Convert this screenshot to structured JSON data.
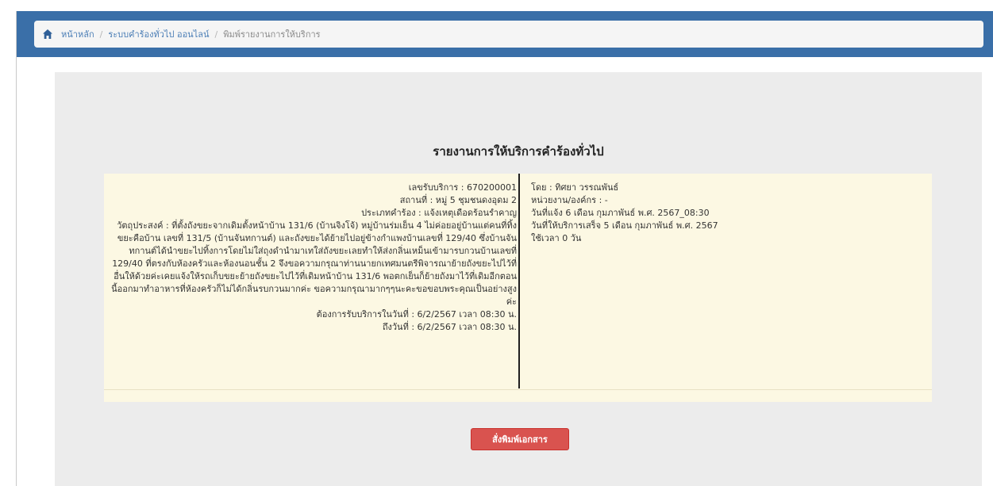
{
  "breadcrumb": {
    "items": [
      {
        "label": "หน้าหลัก"
      },
      {
        "label": "ระบบคำร้องทั่วไป ออนไลน์"
      },
      {
        "label": "พิมพ์รายงานการให้บริการ"
      }
    ],
    "separator": "/"
  },
  "report": {
    "title": "รายงานการให้บริการคำร้องทั่วไป",
    "left": {
      "service_no": "เลขรับบริการ : 670200001",
      "location": "สถานที่ : หมู่ 5 ชุมชนดงอุดม 2",
      "request_type": "ประเภทคำร้อง : แจ้งเหตุเดือดร้อนรำคาญ",
      "purpose": "วัตถุประสงค์ : ที่ตั้งถังขยะจากเดิมตั้งหน้าบ้าน 131/6 (บ้านจิงโจ้) หมู่บ้านร่มเย็น 4 ไม่ค่อยอยู่บ้านแต่คนที่ทิ้งขยะคือบ้าน เลขที่ 131/5 (บ้านจันทกานต์) และถังขยะได้ย้ายไปอยู่ข้างกำแพงบ้านเลขที่ 129/40 ซึ่งบ้านจันทกานต์ได้นำขยะไปทิ้งการโดยไม่ใส่ถุงดำนำมาเทใส่ถังขยะเลยทำให้ส่งกลิ่นเหม็นเข้ามารบกวนบ้านเลขที่ 129/40 ที่ตรงกับห้องครัวและห้องนอนชั้น 2 จึงขอความกรุณาท่านนายกเทศมนตรีพิจารณาย้ายถังขยะไปไว้ที่อื่นให้ด้วยค่ะเคยแจ้งให้รถเก็บขยะย้ายถังขยะไปไว้ที่เดิมหน้าบ้าน 131/6 พอตกเย็นก็ย้ายถังมาไว้ที่เดิมอีกตอนนี้ออกมาทำอาหารที่ห้องครัวก็ไม่ได้กลิ่นรบกวนมากค่ะ ขอความกรุณามากๆๆนะคะขอขอบพระคุณเป็นอย่างสูงค่ะ",
      "need_date": "ต้องการรับบริการในวันที่ : 6/2/2567 เวลา 08:30 น.",
      "until_date": "ถึงวันที่ : 6/2/2567 เวลา 08:30 น."
    },
    "right": {
      "by": "โดย : ทิศยา วรรณพันธ์",
      "unit": "หน่วยงาน/องค์กร : -",
      "report_date": "วันที่แจ้ง 6 เดือน กุมภาพันธ์ พ.ศ. 2567_08:30",
      "done_date": "วันที่ให้บริการเสร็จ 5 เดือน กุมภาพันธ์ พ.ศ. 2567",
      "duration": "ใช้เวลา 0 วัน"
    }
  },
  "actions": {
    "print_label": "สั่งพิมพ์เอกสาร"
  },
  "colors": {
    "header": "#3a6fa8",
    "card": "#fcf8e3",
    "print_button": "#d9534f",
    "panel": "#ececec"
  }
}
